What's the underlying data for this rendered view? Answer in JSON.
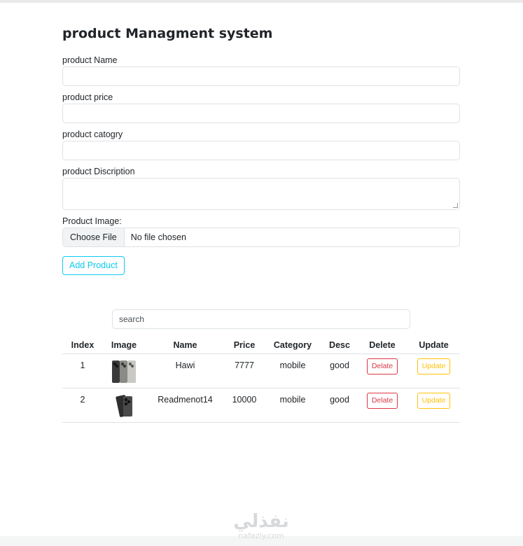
{
  "page": {
    "title": "product Managment system"
  },
  "form": {
    "name_label": "product Name",
    "price_label": "product price",
    "category_label": "product catogry",
    "description_label": "product Discription",
    "image_label": "Product Image:",
    "file_button": "Choose File",
    "file_status": "No file chosen",
    "submit_label": "Add Product"
  },
  "search": {
    "placeholder": "search"
  },
  "table": {
    "headers": [
      "Index",
      "Image",
      "Name",
      "Price",
      "Category",
      "Desc",
      "Delete",
      "Update"
    ],
    "rows": [
      {
        "index": "1",
        "name": "Hawi",
        "price": "7777",
        "category": "mobile",
        "desc": "good",
        "delete": "Delate",
        "update": "Update"
      },
      {
        "index": "2",
        "name": "Readmenot14",
        "price": "10000",
        "category": "mobile",
        "desc": "good",
        "delete": "Delate",
        "update": "Update"
      }
    ]
  },
  "watermark": {
    "logo": "نفذلي",
    "site": "nafezly.com"
  },
  "colors": {
    "info": "#0dcaf0",
    "danger": "#dc3545",
    "warning": "#ffc107",
    "border": "#dee2e6"
  }
}
